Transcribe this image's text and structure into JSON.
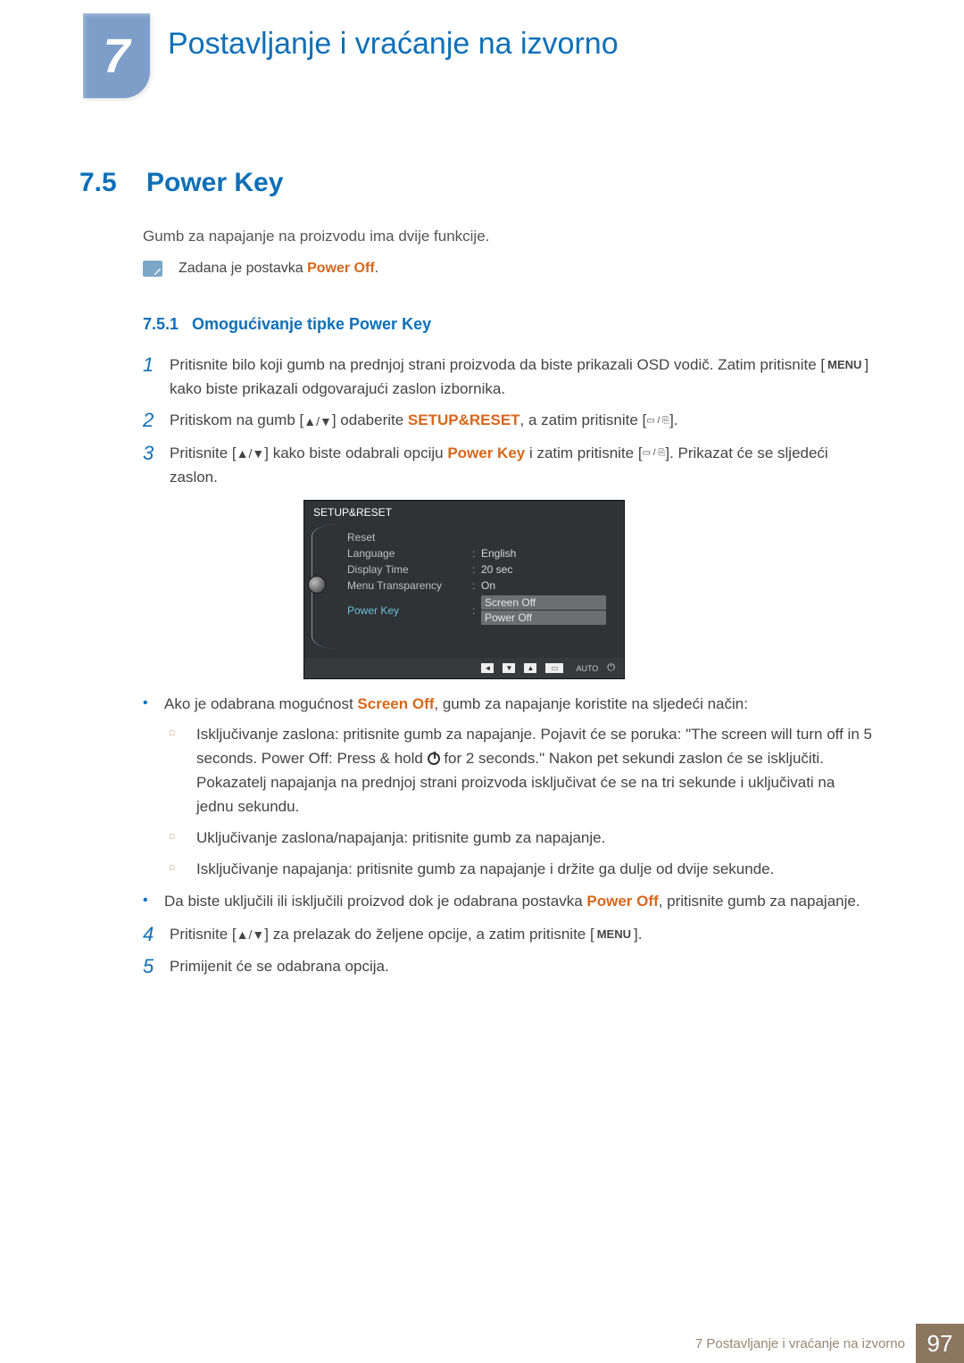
{
  "chapter": {
    "number": "7",
    "title": "Postavljanje i vraćanje na izvorno"
  },
  "section": {
    "number": "7.5",
    "title": "Power Key"
  },
  "intro": "Gumb za napajanje na proizvodu ima dvije funkcije.",
  "note": {
    "prefix": "Zadana je postavka ",
    "value": "Power Off",
    "suffix": "."
  },
  "subsection": {
    "number": "7.5.1",
    "title": "Omogućivanje tipke Power Key"
  },
  "steps": {
    "s1": {
      "num": "1",
      "part1": "Pritisnite bilo koji gumb na prednjoj strani proizvoda da biste prikazali OSD vodič. Zatim pritisnite [",
      "menu": "MENU",
      "part2": "] kako biste prikazali odgovarajući zaslon izbornika."
    },
    "s2": {
      "num": "2",
      "part1": "Pritiskom na gumb [",
      "arrows": "▲/▼",
      "part2": "] odaberite ",
      "accent": "SETUP&RESET",
      "part3": ", a zatim pritisnite [",
      "nav": "▭ / ⎘",
      "part4": "]."
    },
    "s3": {
      "num": "3",
      "part1": "Pritisnite [",
      "arrows": "▲/▼",
      "part2": "] kako biste odabrali opciju ",
      "accent": "Power Key",
      "part3": " i zatim pritisnite [",
      "nav": "▭ / ⎘",
      "part4": "]. Prikazat će se sljedeći zaslon."
    },
    "s4": {
      "num": "4",
      "part1": "Pritisnite [",
      "arrows": "▲/▼",
      "part2": "] za prelazak do željene opcije, a zatim pritisnite [",
      "menu": "MENU",
      "part3": "]."
    },
    "s5": {
      "num": "5",
      "text": "Primijenit će se odabrana opcija."
    }
  },
  "osd": {
    "title": "SETUP&RESET",
    "rows": {
      "reset": "Reset",
      "language_l": "Language",
      "language_v": "English",
      "display_l": "Display Time",
      "display_v": "20 sec",
      "trans_l": "Menu Transparency",
      "trans_v": "On",
      "power_l": "Power Key",
      "opt1": "Screen Off",
      "opt2": "Power Off"
    },
    "footer": {
      "auto": "AUTO"
    }
  },
  "bullets": {
    "b1a_pre": "Ako je odabrana mogućnost ",
    "b1a_acc": "Screen Off",
    "b1a_post": ", gumb za napajanje koristite na sljedeći način:",
    "sub1_pre": "Isključivanje zaslona: pritisnite gumb za napajanje. Pojavit će se poruka: \"The screen will turn off in 5 seconds. Power Off: Press & hold ",
    "sub1_post": " for 2 seconds.\" Nakon pet sekundi zaslon će se isključiti. Pokazatelj napajanja na prednjoj strani proizvoda isključivat će se na tri sekunde i uključivati na jednu sekundu.",
    "sub2": "Uključivanje zaslona/napajanja: pritisnite gumb za napajanje.",
    "sub3": "Isključivanje napajanja: pritisnite gumb za napajanje i držite ga dulje od dvije sekunde.",
    "b1b_pre": "Da biste uključili ili isključili proizvod dok je odabrana postavka ",
    "b1b_acc": "Power Off",
    "b1b_post": ", pritisnite gumb za napajanje."
  },
  "footer": {
    "title": "7 Postavljanje i vraćanje na izvorno",
    "page": "97"
  }
}
